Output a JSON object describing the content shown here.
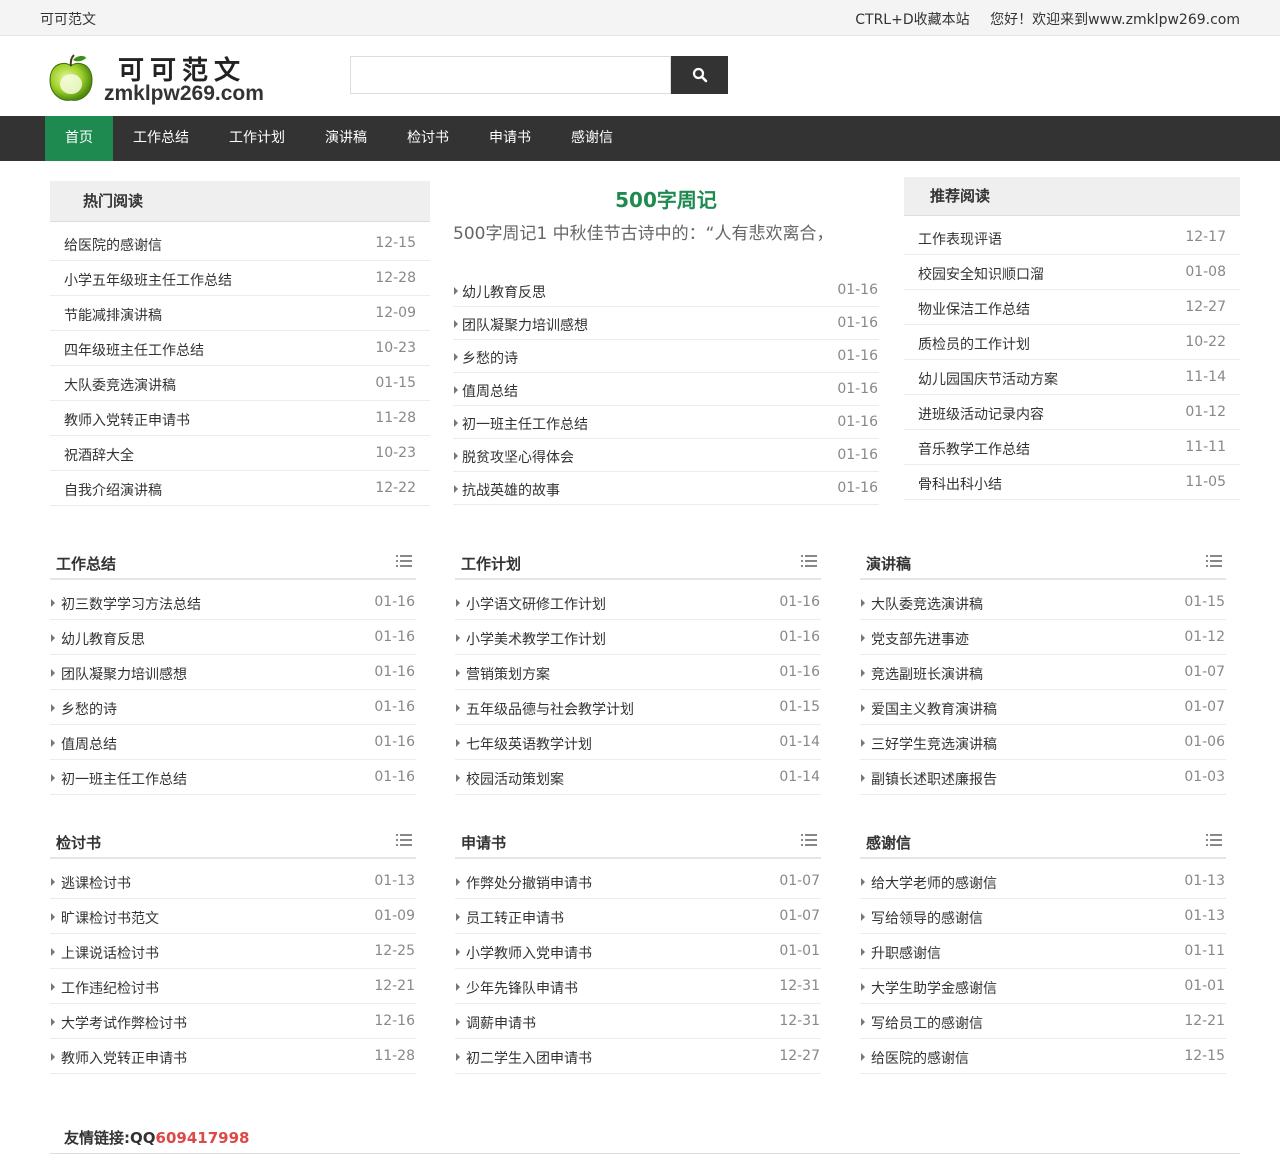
{
  "topbar": {
    "site_name": "可可范文",
    "bookmark": "CTRL+D收藏本站",
    "welcome": "您好！欢迎来到www.zmklpw269.com"
  },
  "logo": {
    "cn": "可可范文",
    "domain": "zmklpw269.com"
  },
  "search": {
    "placeholder": ""
  },
  "nav": [
    {
      "label": "首页",
      "active": true
    },
    {
      "label": "工作总结"
    },
    {
      "label": "工作计划"
    },
    {
      "label": "演讲稿"
    },
    {
      "label": "检讨书"
    },
    {
      "label": "申请书"
    },
    {
      "label": "感谢信"
    }
  ],
  "hot": {
    "title": "热门阅读",
    "items": [
      {
        "title": "给医院的感谢信",
        "date": "12-15"
      },
      {
        "title": "小学五年级班主任工作总结",
        "date": "12-28"
      },
      {
        "title": "节能减排演讲稿",
        "date": "12-09"
      },
      {
        "title": "四年级班主任工作总结",
        "date": "10-23"
      },
      {
        "title": "大队委竞选演讲稿",
        "date": "01-15"
      },
      {
        "title": "教师入党转正申请书",
        "date": "11-28"
      },
      {
        "title": "祝酒辞大全",
        "date": "10-23"
      },
      {
        "title": "自我介绍演讲稿",
        "date": "12-22"
      }
    ]
  },
  "featured": {
    "title": "500字周记",
    "summary": "500字周记1 中秋佳节古诗中的：“人有悲欢离合，",
    "items": [
      {
        "title": "幼儿教育反思",
        "date": "01-16"
      },
      {
        "title": "团队凝聚力培训感想",
        "date": "01-16"
      },
      {
        "title": "乡愁的诗",
        "date": "01-16"
      },
      {
        "title": "值周总结",
        "date": "01-16"
      },
      {
        "title": "初一班主任工作总结",
        "date": "01-16"
      },
      {
        "title": "脱贫攻坚心得体会",
        "date": "01-16"
      },
      {
        "title": "抗战英雄的故事",
        "date": "01-16"
      }
    ]
  },
  "recommend": {
    "title": "推荐阅读",
    "items": [
      {
        "title": "工作表现评语",
        "date": "12-17"
      },
      {
        "title": "校园安全知识顺口溜",
        "date": "01-08"
      },
      {
        "title": "物业保洁工作总结",
        "date": "12-27"
      },
      {
        "title": "质检员的工作计划",
        "date": "10-22"
      },
      {
        "title": "幼儿园国庆节活动方案",
        "date": "11-14"
      },
      {
        "title": "进班级活动记录内容",
        "date": "01-12"
      },
      {
        "title": "音乐教学工作总结",
        "date": "11-11"
      },
      {
        "title": "骨科出科小结",
        "date": "11-05"
      }
    ]
  },
  "categories": [
    {
      "title": "工作总结",
      "items": [
        {
          "title": "初三数学学习方法总结",
          "date": "01-16"
        },
        {
          "title": "幼儿教育反思",
          "date": "01-16"
        },
        {
          "title": "团队凝聚力培训感想",
          "date": "01-16"
        },
        {
          "title": "乡愁的诗",
          "date": "01-16"
        },
        {
          "title": "值周总结",
          "date": "01-16"
        },
        {
          "title": "初一班主任工作总结",
          "date": "01-16"
        }
      ]
    },
    {
      "title": "工作计划",
      "items": [
        {
          "title": "小学语文研修工作计划",
          "date": "01-16"
        },
        {
          "title": "小学美术教学工作计划",
          "date": "01-16"
        },
        {
          "title": "营销策划方案",
          "date": "01-16"
        },
        {
          "title": "五年级品德与社会教学计划",
          "date": "01-15"
        },
        {
          "title": "七年级英语教学计划",
          "date": "01-14"
        },
        {
          "title": "校园活动策划案",
          "date": "01-14"
        }
      ]
    },
    {
      "title": "演讲稿",
      "items": [
        {
          "title": "大队委竞选演讲稿",
          "date": "01-15"
        },
        {
          "title": "党支部先进事迹",
          "date": "01-12"
        },
        {
          "title": "竞选副班长演讲稿",
          "date": "01-07"
        },
        {
          "title": "爱国主义教育演讲稿",
          "date": "01-07"
        },
        {
          "title": "三好学生竞选演讲稿",
          "date": "01-06"
        },
        {
          "title": "副镇长述职述廉报告",
          "date": "01-03"
        }
      ]
    },
    {
      "title": "检讨书",
      "items": [
        {
          "title": "逃课检讨书",
          "date": "01-13"
        },
        {
          "title": "旷课检讨书范文",
          "date": "01-09"
        },
        {
          "title": "上课说话检讨书",
          "date": "12-25"
        },
        {
          "title": "工作违纪检讨书",
          "date": "12-21"
        },
        {
          "title": "大学考试作弊检讨书",
          "date": "12-16"
        },
        {
          "title": "教师入党转正申请书",
          "date": "11-28"
        }
      ]
    },
    {
      "title": "申请书",
      "items": [
        {
          "title": "作弊处分撤销申请书",
          "date": "01-07"
        },
        {
          "title": "员工转正申请书",
          "date": "01-07"
        },
        {
          "title": "小学教师入党申请书",
          "date": "01-01"
        },
        {
          "title": "少年先锋队申请书",
          "date": "12-31"
        },
        {
          "title": "调薪申请书",
          "date": "12-31"
        },
        {
          "title": "初二学生入团申请书",
          "date": "12-27"
        }
      ]
    },
    {
      "title": "感谢信",
      "items": [
        {
          "title": "给大学老师的感谢信",
          "date": "01-13"
        },
        {
          "title": "写给领导的感谢信",
          "date": "01-13"
        },
        {
          "title": "升职感谢信",
          "date": "01-11"
        },
        {
          "title": "大学生助学金感谢信",
          "date": "01-01"
        },
        {
          "title": "写给员工的感谢信",
          "date": "12-21"
        },
        {
          "title": "给医院的感谢信",
          "date": "12-15"
        }
      ]
    }
  ],
  "friend_links": {
    "label": "友情链接:QQ",
    "qq": "609417998"
  },
  "colors": {
    "accent_green": "#1e8a4f",
    "nav_bg": "#333333",
    "qq_red": "#e04848"
  }
}
